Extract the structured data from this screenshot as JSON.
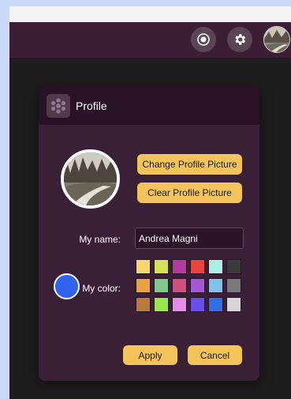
{
  "topbar": {
    "icons": [
      "record-icon",
      "gear-icon"
    ]
  },
  "dialog": {
    "title": "Profile",
    "change_picture_label": "Change Profile Picture",
    "clear_picture_label": "Clear Profile Picture",
    "name_label": "My name:",
    "name_value": "Andrea Magni",
    "color_label": "My color:",
    "selected_color": "#2f63f0",
    "apply_label": "Apply",
    "cancel_label": "Cancel",
    "palette": [
      "#f5d76e",
      "#d4e157",
      "#b53aa0",
      "#e8453c",
      "#a8f0e6",
      "#3a3a3a",
      "#e8a23e",
      "#7ec98b",
      "#d14f7c",
      "#a35ad0",
      "#7fc3ea",
      "#7a7a7a",
      "#b97a3a",
      "#9ae64a",
      "#e58ce8",
      "#6a4ff0",
      "#2f6fe8",
      "#d6d6d6"
    ]
  },
  "colors": {
    "accent": "#f4c35a",
    "topbar": "#3b1d36",
    "dialog_bg": "#3a2037",
    "dialog_header": "#2a1226"
  }
}
